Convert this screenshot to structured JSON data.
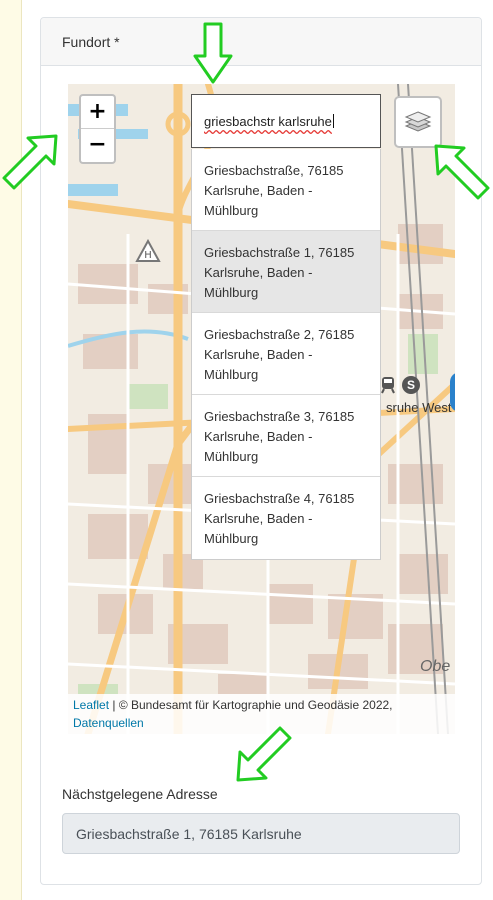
{
  "section": {
    "title": "Fundort *"
  },
  "map": {
    "zoom_in": "+",
    "zoom_out": "−",
    "search_value": "griesbachstr karlsruhe",
    "results": [
      "Griesbachstraße, 76185 Karlsruhe, Baden - Mühlburg",
      "Griesbachstraße 1, 76185 Karlsruhe, Baden - Mühlburg",
      "Griesbachstraße 2, 76185 Karlsruhe, Baden - Mühlburg",
      "Griesbachstraße 3, 76185 Karlsruhe, Baden - Mühlburg",
      "Griesbachstraße 4, 76185 Karlsruhe, Baden - Mühlburg"
    ],
    "highlighted_result": 1,
    "layers_icon": "layers-icon",
    "labels": {
      "station": "sruhe West",
      "district": "Obe"
    },
    "attribution": {
      "leaflet": "Leaflet",
      "separator": " | ",
      "copyright": "© Bundesamt für Kartographie und Geodäsie 2022,",
      "sources": "Datenquellen"
    }
  },
  "nearest_address": {
    "label": "Nächstgelegene Adresse",
    "value": "Griesbachstraße 1, 76185 Karlsruhe"
  },
  "colors": {
    "annotation_arrow": "#22cc22",
    "map_major_road": "#f7c980",
    "map_water": "#8ecbe8",
    "map_building": "#e0c9bc",
    "link": "#0078a8"
  }
}
